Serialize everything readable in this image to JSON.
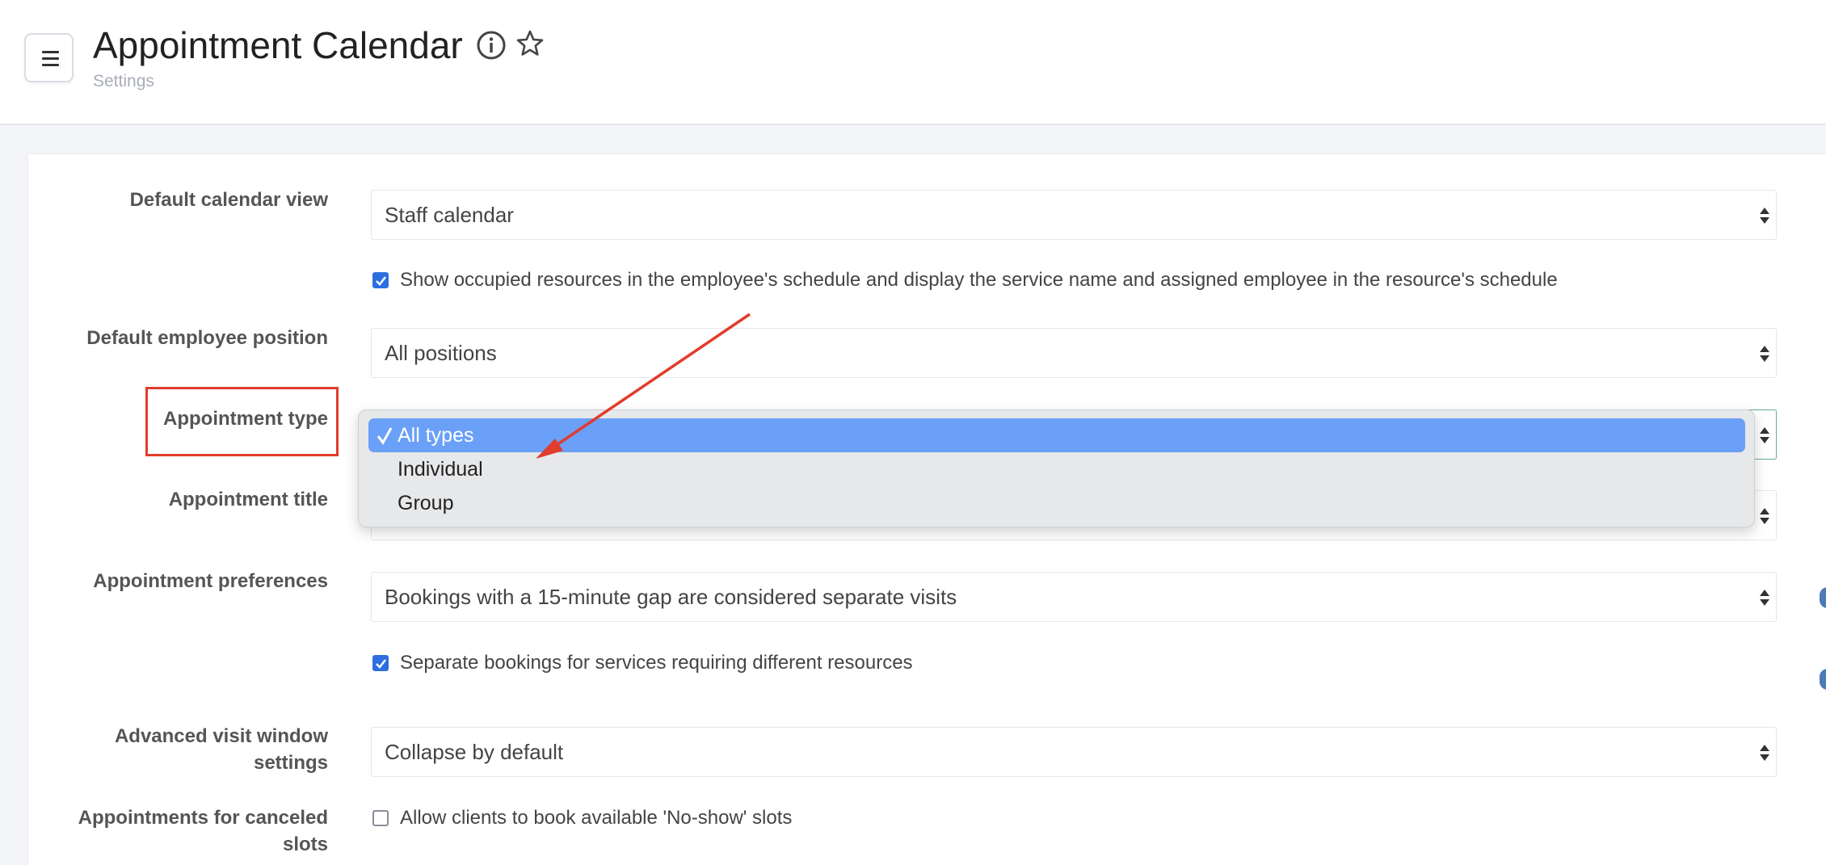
{
  "header": {
    "title": "Appointment Calendar",
    "breadcrumb": "Settings"
  },
  "form": {
    "default_view": {
      "label": "Default calendar view",
      "value": "Staff calendar"
    },
    "show_occupied": {
      "label": "Show occupied resources in the employee's schedule and display the service name and assigned employee in the resource's schedule",
      "checked": true
    },
    "employee_position": {
      "label": "Default employee position",
      "value": "All positions"
    },
    "appointment_type": {
      "label": "Appointment type",
      "options": [
        "All types",
        "Individual",
        "Group"
      ],
      "selected": "All types"
    },
    "appointment_title": {
      "label": "Appointment title"
    },
    "preferences": {
      "label": "Appointment preferences",
      "value": "Bookings with a 15-minute gap are considered separate visits"
    },
    "separate_bookings": {
      "label": "Separate bookings for services requiring different resources",
      "checked": true
    },
    "visit_window": {
      "label_line1": "Advanced visit window",
      "label_line2": "settings",
      "value": "Collapse by default"
    },
    "canceled_slots": {
      "label_line1": "Appointments for canceled",
      "label_line2": "slots"
    },
    "no_show": {
      "label": "Allow clients to book available 'No-show' slots",
      "checked": false
    }
  },
  "colors": {
    "accent_blue": "#2d6fe0",
    "selected_option": "#6aa0f7",
    "annotation_red": "#e23c2c"
  }
}
